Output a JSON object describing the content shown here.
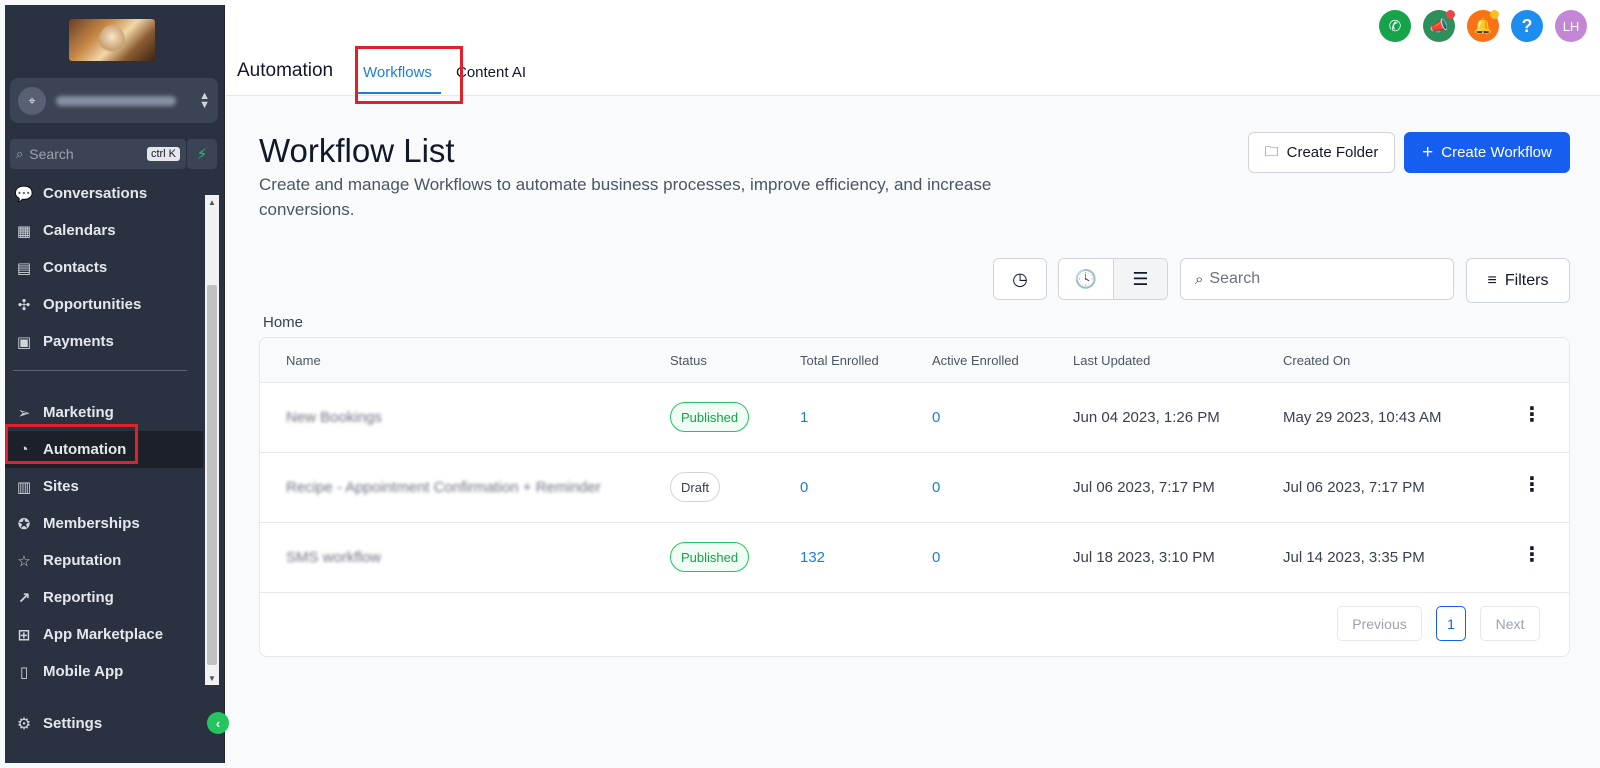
{
  "sidebar": {
    "location_name": "360 Jasmine Acupuncture",
    "search": {
      "placeholder": "Search",
      "shortcut": "ctrl K"
    },
    "items": [
      {
        "label": "Conversations",
        "icon": "chat-icon"
      },
      {
        "label": "Calendars",
        "icon": "calendar-icon"
      },
      {
        "label": "Contacts",
        "icon": "contacts-icon"
      },
      {
        "label": "Opportunities",
        "icon": "opportunities-icon"
      },
      {
        "label": "Payments",
        "icon": "payments-icon"
      },
      {
        "label": "Marketing",
        "icon": "send-icon"
      },
      {
        "label": "Automation",
        "icon": "automation-icon",
        "active": true
      },
      {
        "label": "Sites",
        "icon": "sites-icon"
      },
      {
        "label": "Memberships",
        "icon": "memberships-icon"
      },
      {
        "label": "Reputation",
        "icon": "star-icon"
      },
      {
        "label": "Reporting",
        "icon": "trend-icon"
      },
      {
        "label": "App Marketplace",
        "icon": "grid-icon"
      },
      {
        "label": "Mobile App",
        "icon": "mobile-icon"
      }
    ],
    "settings_label": "Settings"
  },
  "topbar": {
    "title": "Automation",
    "tabs": [
      {
        "label": "Workflows",
        "active": true
      },
      {
        "label": "Content AI"
      }
    ],
    "avatar_initials": "LH"
  },
  "main": {
    "title": "Workflow List",
    "description": "Create and manage Workflows to automate business processes, improve efficiency, and increase conversions.",
    "create_folder_label": "Create Folder",
    "create_workflow_label": "Create Workflow",
    "search_placeholder": "Search",
    "filters_label": "Filters",
    "breadcrumb": "Home"
  },
  "table": {
    "columns": [
      "Name",
      "Status",
      "Total Enrolled",
      "Active Enrolled",
      "Last Updated",
      "Created On"
    ],
    "rows": [
      {
        "name": "New Bookings",
        "status": "Published",
        "total": "1",
        "active": "0",
        "updated": "Jun 04 2023, 1:26 PM",
        "created": "May 29 2023, 10:43 AM"
      },
      {
        "name": "Recipe - Appointment Confirmation + Reminder",
        "status": "Draft",
        "total": "0",
        "active": "0",
        "updated": "Jul 06 2023, 7:17 PM",
        "created": "Jul 06 2023, 7:17 PM"
      },
      {
        "name": "SMS workflow",
        "status": "Published",
        "total": "132",
        "active": "0",
        "updated": "Jul 18 2023, 3:10 PM",
        "created": "Jul 14 2023, 3:35 PM"
      }
    ]
  },
  "pagination": {
    "previous": "Previous",
    "current": "1",
    "next": "Next"
  },
  "colors": {
    "sidebar_bg": "#2a3241",
    "accent": "#155eef",
    "tab_active": "#1c7fd4",
    "published": "#16a34a",
    "highlight": "#e0202a"
  }
}
